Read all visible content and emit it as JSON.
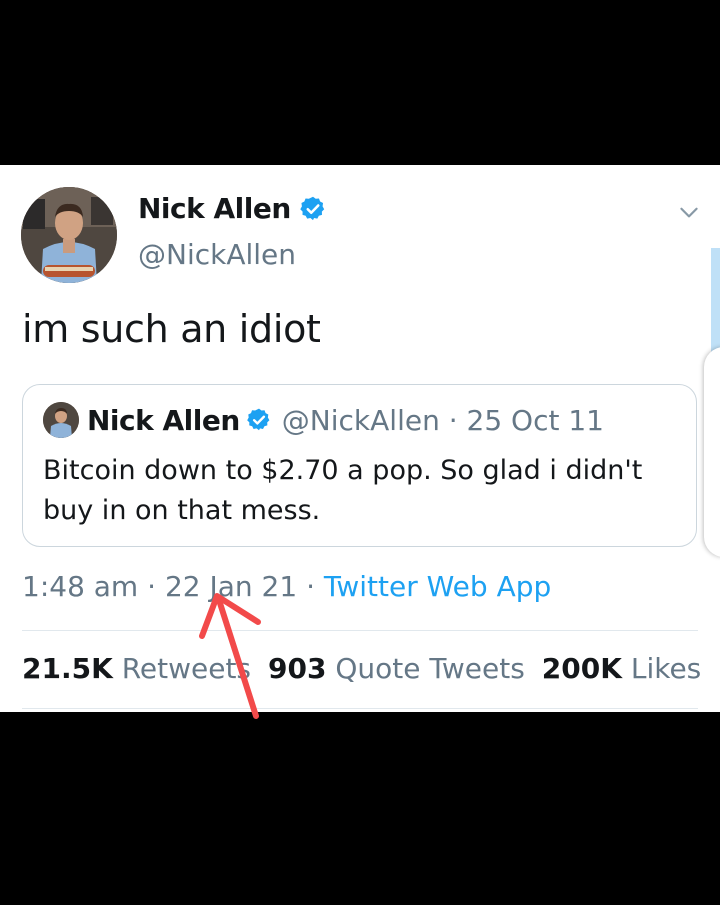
{
  "tweet": {
    "author_name": "Nick Allen",
    "author_handle": "@NickAllen",
    "text": "im such an idiot",
    "time": "1:48 am",
    "date": "22 Jan 21",
    "separator": "·",
    "source_app": "Twitter Web App"
  },
  "quoted_tweet": {
    "author_name": "Nick Allen",
    "meta": "@NickAllen · 25 Oct 11",
    "text": "Bitcoin down to $2.70 a pop. So glad i didn't buy in on that mess."
  },
  "stats": {
    "retweets_count": "21.5K",
    "retweets_label": "Retweets",
    "quotes_count": "903",
    "quotes_label": "Quote Tweets",
    "likes_count": "200K",
    "likes_label": "Likes"
  },
  "colors": {
    "verified": "#1da1f2",
    "link": "#1da1f2",
    "annotation_arrow": "#f24a4a",
    "secondary_text": "#657786"
  },
  "icons": {
    "verified": "verified-badge-icon",
    "more": "chevron-down-icon",
    "annotation": "red-arrow-annotation"
  }
}
